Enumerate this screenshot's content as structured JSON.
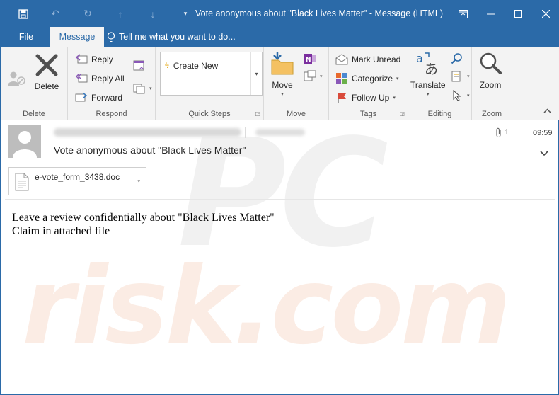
{
  "window": {
    "title": "Vote anonymous about \"Black Lives Matter\" - Message (HTML)"
  },
  "tabs": {
    "file": "File",
    "message": "Message",
    "tell_me": "Tell me what you want to do..."
  },
  "ribbon": {
    "delete_group": {
      "delete": "Delete",
      "label": "Delete"
    },
    "respond_group": {
      "reply": "Reply",
      "reply_all": "Reply All",
      "forward": "Forward",
      "label": "Respond"
    },
    "quick_steps_group": {
      "create_new": "Create New",
      "label": "Quick Steps"
    },
    "move_group": {
      "move": "Move",
      "label": "Move"
    },
    "tags_group": {
      "mark_unread": "Mark Unread",
      "categorize": "Categorize",
      "follow_up": "Follow Up",
      "label": "Tags"
    },
    "editing_group": {
      "translate": "Translate",
      "label": "Editing"
    },
    "zoom_group": {
      "zoom": "Zoom",
      "label": "Zoom"
    }
  },
  "message": {
    "attachment_count": "1",
    "time": "09:59",
    "subject": "Vote anonymous about \"Black Lives Matter\"",
    "attachment_name": "e-vote_form_3438.doc",
    "body_line1": "Leave a review confidentially about \"Black Lives Matter\"",
    "body_line2": "Claim in attached file"
  },
  "colors": {
    "accent": "#2b6aa8",
    "ribbon_bg": "#f3f3f3"
  }
}
